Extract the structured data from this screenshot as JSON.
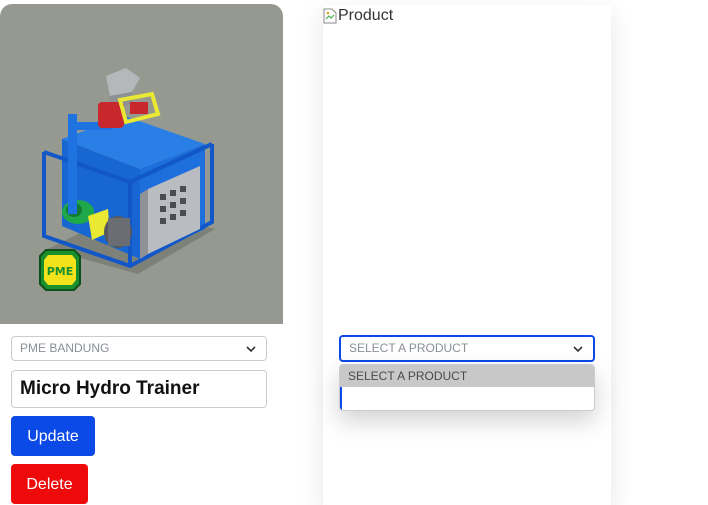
{
  "left_card": {
    "company_select": {
      "value": "PME BANDUNG"
    },
    "product_name": "Micro Hydro Trainer",
    "update_label": "Update",
    "delete_label": "Delete",
    "logo_text": "PME"
  },
  "right_card": {
    "image_alt": "Product",
    "product_select": {
      "value": "SELECT A PRODUCT"
    },
    "options": [
      "SELECT A PRODUCT",
      ""
    ]
  },
  "colors": {
    "primary": "#0b4ae6",
    "danger": "#ee0a0a",
    "image_bg": "#95998f",
    "machine_blue": "#1e73e0",
    "logo_green": "#1a8f2e",
    "logo_yellow": "#f2e21b"
  },
  "icons": [
    "chevron-down-icon",
    "broken-image-icon"
  ]
}
